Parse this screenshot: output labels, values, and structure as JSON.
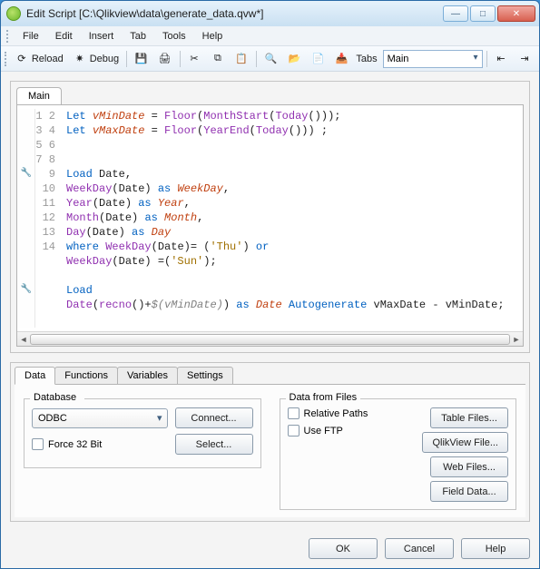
{
  "window": {
    "title": "Edit Script [C:\\Qlikview\\data\\generate_data.qvw*]"
  },
  "menu": {
    "file": "File",
    "edit": "Edit",
    "insert": "Insert",
    "tab": "Tab",
    "tools": "Tools",
    "help": "Help"
  },
  "toolbar": {
    "reload": "Reload",
    "debug": "Debug",
    "tabs_label": "Tabs",
    "tabs_value": "Main"
  },
  "script": {
    "tab_main": "Main",
    "lines": [
      "Let vMinDate = Floor(MonthStart(Today()));",
      "Let vMaxDate = Floor(YearEnd(Today())) ;",
      "",
      "",
      "Load Date,",
      "WeekDay(Date) as WeekDay,",
      "Year(Date) as Year,",
      "Month(Date) as Month,",
      "Day(Date) as Day",
      "where WeekDay(Date)= ('Thu') or",
      "WeekDay(Date) =('Sun');",
      "",
      "Load",
      "Date(recno()+$(vMinDate)) as Date Autogenerate vMaxDate - vMinDate;"
    ]
  },
  "bottom": {
    "tabs": {
      "data": "Data",
      "functions": "Functions",
      "variables": "Variables",
      "settings": "Settings"
    },
    "database_legend": "Database",
    "database_value": "ODBC",
    "connect": "Connect...",
    "select": "Select...",
    "force32": "Force 32 Bit",
    "datafrom_legend": "Data from Files",
    "relpaths": "Relative Paths",
    "useftp": "Use FTP",
    "table_files": "Table Files...",
    "qlikview_file": "QlikView File...",
    "web_files": "Web Files...",
    "field_data": "Field Data..."
  },
  "footer": {
    "ok": "OK",
    "cancel": "Cancel",
    "help": "Help"
  }
}
